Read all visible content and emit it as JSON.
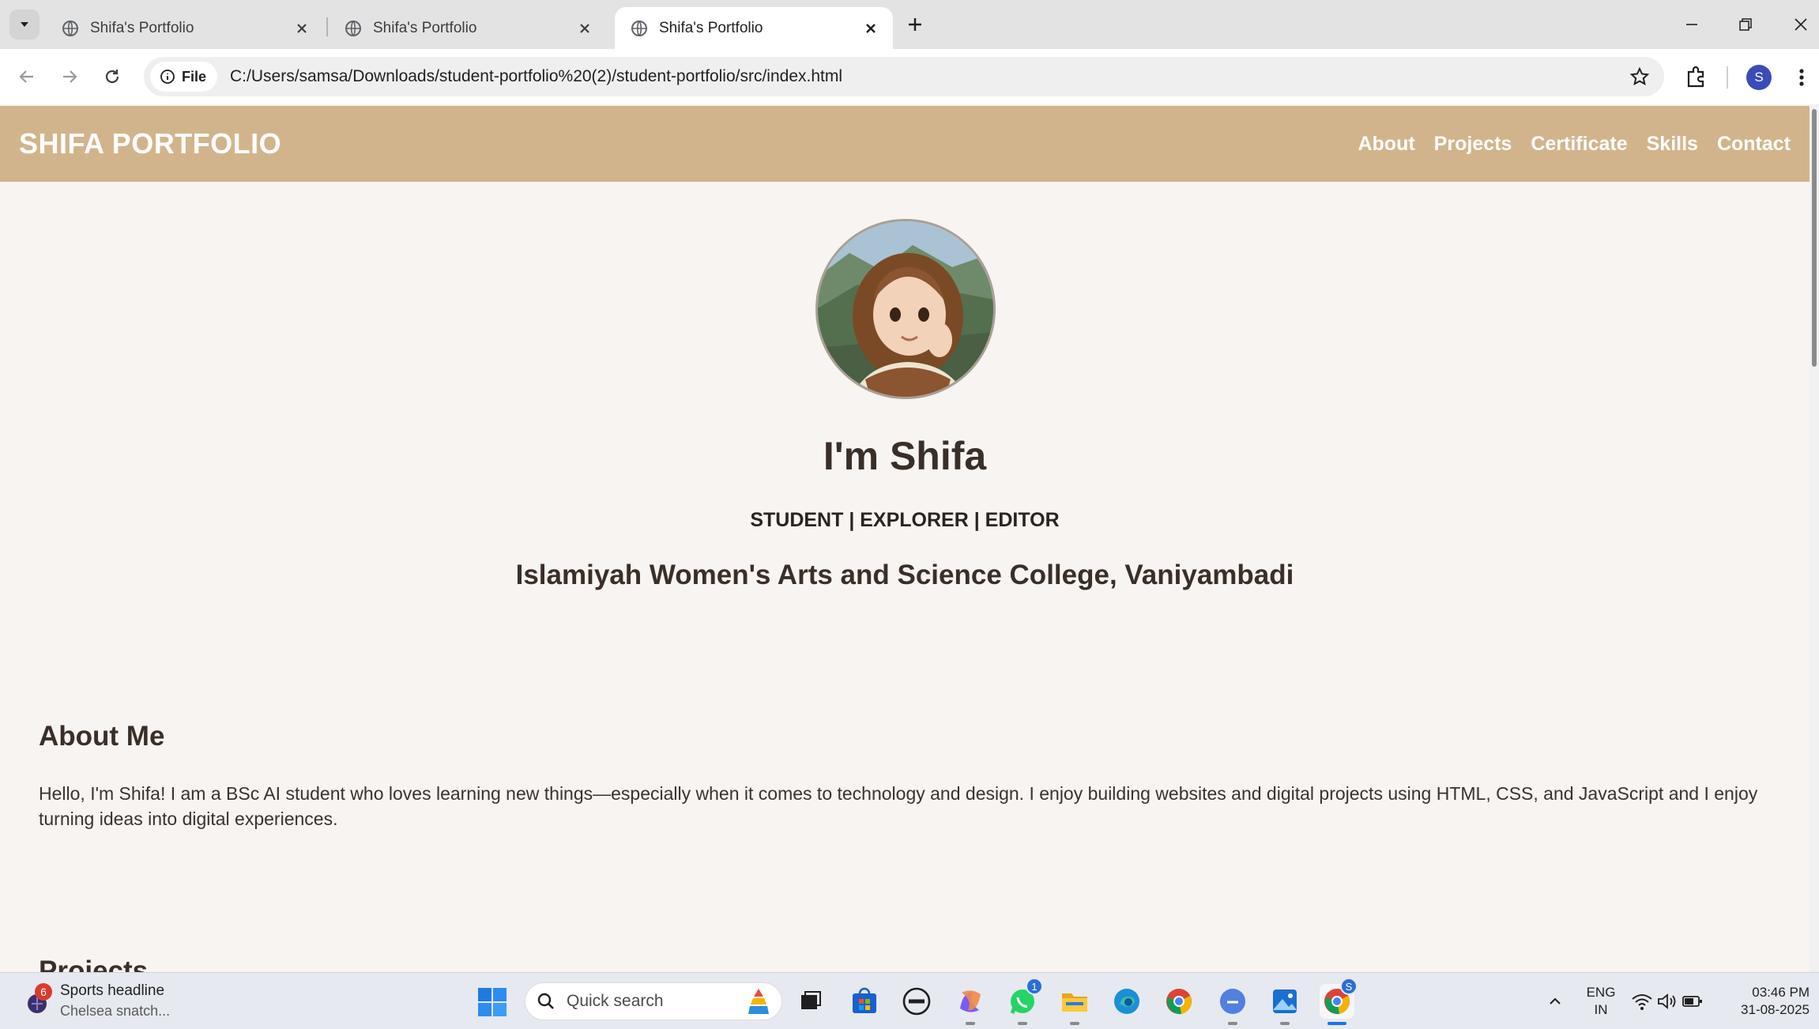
{
  "browser": {
    "tabs": [
      {
        "title": "Shifa's Portfolio",
        "active": false
      },
      {
        "title": "Shifa's Portfolio",
        "active": false
      },
      {
        "title": "Shifa's Portfolio",
        "active": true
      }
    ],
    "chip_label": "File",
    "url": "C:/Users/samsa/Downloads/student-portfolio%20(2)/student-portfolio/src/index.html",
    "profile_initial": "S"
  },
  "site": {
    "brand": "SHIFA PORTFOLIO",
    "nav": [
      "About",
      "Projects",
      "Certificate",
      "Skills",
      "Contact"
    ],
    "hero": {
      "name": "I'm Shifa",
      "tagline": "STUDENT | EXPLORER | EDITOR",
      "college": "Islamiyah Women's Arts and Science College, Vaniyambadi"
    },
    "about": {
      "title": "About Me",
      "text": "Hello, I'm Shifa! I am a BSc AI student who loves learning new things—especially when it comes to technology and design. I enjoy building websites and digital projects using HTML, CSS, and JavaScript and I enjoy turning ideas into digital experiences."
    },
    "projects_title": "Projects"
  },
  "taskbar": {
    "widget": {
      "title": "Sports headline",
      "subtitle": "Chelsea snatch...",
      "badge": "6"
    },
    "search_placeholder": "Quick search",
    "whatsapp_badge": "1",
    "chrome_badge": "S",
    "language": "ENG",
    "region": "IN",
    "time": "03:46 PM",
    "date": "31-08-2025"
  },
  "colors": {
    "header_bg": "#d2b48c",
    "page_bg": "#f7f4f2",
    "text_dark": "#3a2f28"
  }
}
